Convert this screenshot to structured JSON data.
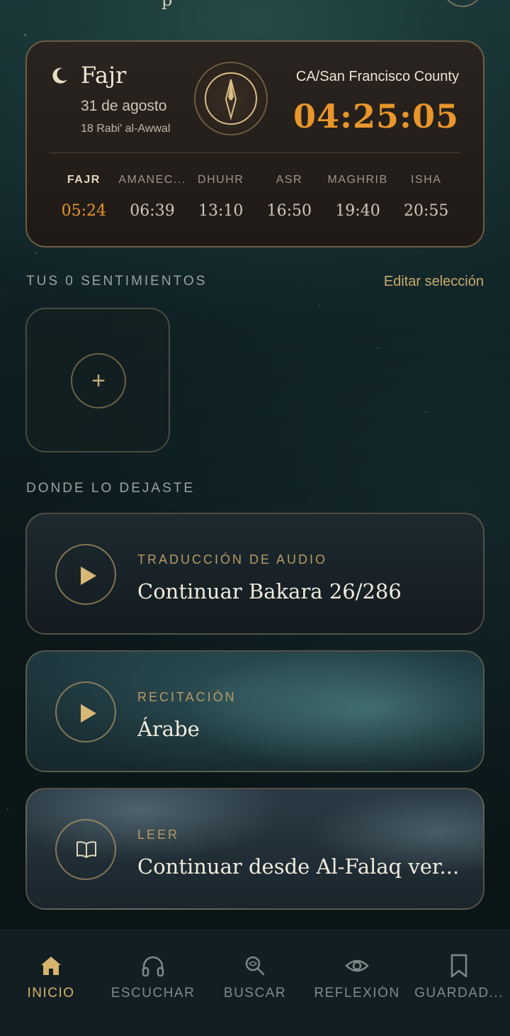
{
  "top": {
    "partial_text": "p"
  },
  "prayer_card": {
    "current_prayer": "Fajr",
    "date_gregorian": "31 de agosto",
    "date_hijri": "18 Rabi' al-Awwal",
    "location": "CA/San Francisco County",
    "countdown": "04:25:05",
    "times": [
      {
        "label": "FAJR",
        "time": "05:24",
        "active": true
      },
      {
        "label": "AMANEC...",
        "time": "06:39",
        "active": false
      },
      {
        "label": "DHUHR",
        "time": "13:10",
        "active": false
      },
      {
        "label": "ASR",
        "time": "16:50",
        "active": false
      },
      {
        "label": "MAGHRIB",
        "time": "19:40",
        "active": false
      },
      {
        "label": "ISHA",
        "time": "20:55",
        "active": false
      }
    ],
    "accent_color": "#e9962a"
  },
  "feelings": {
    "title": "TUS 0 SENTIMIENTOS",
    "edit_label": "Editar selección",
    "add_symbol": "+"
  },
  "continue": {
    "title": "DONDE LO DEJASTE",
    "cards": [
      {
        "kicker": "TRADUCCIÓN DE AUDIO",
        "title": "Continuar Bakara 26/286",
        "icon": "play-icon"
      },
      {
        "kicker": "RECITACIÓN",
        "title": "Árabe",
        "icon": "play-icon"
      },
      {
        "kicker": "LEER",
        "title": "Continuar desde Al-Falaq ver...",
        "icon": "book-icon"
      }
    ]
  },
  "nav": {
    "items": [
      {
        "label": "INICIO",
        "icon": "home-icon",
        "active": true
      },
      {
        "label": "ESCUCHAR",
        "icon": "headphones-icon",
        "active": false
      },
      {
        "label": "BUSCAR",
        "icon": "search-icon",
        "active": false
      },
      {
        "label": "REFLEXIÓN",
        "icon": "eye-icon",
        "active": false
      },
      {
        "label": "GUARDAD...",
        "icon": "bookmark-icon",
        "active": false
      }
    ],
    "active_color": "#d6b46c"
  }
}
